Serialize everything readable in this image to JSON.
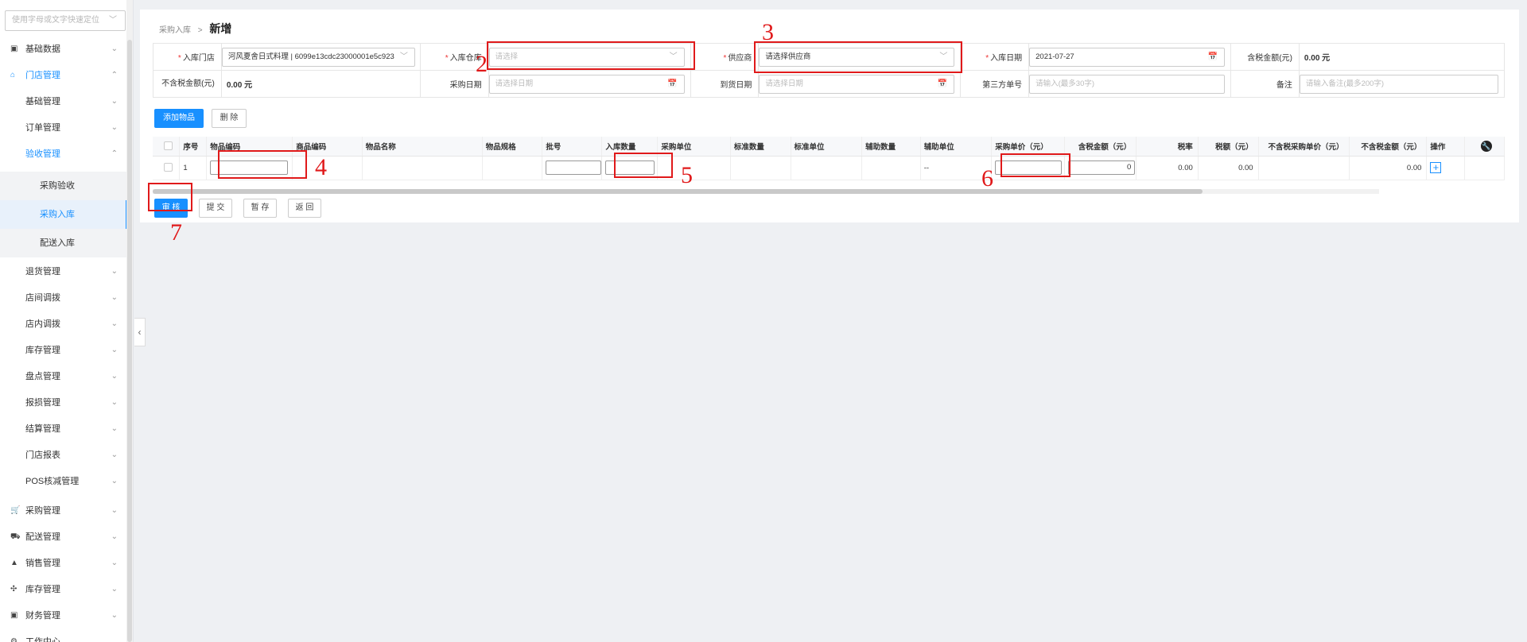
{
  "sidebar": {
    "search_placeholder": "使用字母或文字快速定位",
    "items": [
      {
        "label": "基础数据",
        "icon": "database-icon"
      },
      {
        "label": "门店管理",
        "icon": "store-icon"
      },
      {
        "label": "基础管理"
      },
      {
        "label": "订单管理"
      },
      {
        "label": "验收管理"
      },
      {
        "label": "采购验收"
      },
      {
        "label": "采购入库"
      },
      {
        "label": "配送入库"
      },
      {
        "label": "退货管理"
      },
      {
        "label": "店间调拨"
      },
      {
        "label": "店内调拨"
      },
      {
        "label": "库存管理"
      },
      {
        "label": "盘点管理"
      },
      {
        "label": "报损管理"
      },
      {
        "label": "结算管理"
      },
      {
        "label": "门店报表"
      },
      {
        "label": "POS核减管理"
      },
      {
        "label": "采购管理",
        "icon": "cart-icon"
      },
      {
        "label": "配送管理",
        "icon": "truck-icon"
      },
      {
        "label": "销售管理",
        "icon": "sales-icon"
      },
      {
        "label": "库存管理",
        "icon": "inventory-icon"
      },
      {
        "label": "财务管理",
        "icon": "finance-icon"
      },
      {
        "label": "工作中心",
        "icon": "work-icon"
      }
    ]
  },
  "breadcrumb": {
    "parent": "采购入库",
    "separator": ">",
    "current": "新增"
  },
  "form": {
    "store_label": "入库门店",
    "store_value": "河风夏舍日式料理 | 6099e13cdc23000001e5c923",
    "warehouse_label": "入库仓库",
    "warehouse_placeholder": "请选择",
    "supplier_label": "供应商",
    "supplier_placeholder": "请选择供应商",
    "date_label": "入库日期",
    "date_value": "2021-07-27",
    "tax_amount_label": "含税金额(元)",
    "tax_amount_value": "0.00 元",
    "notax_amount_label": "不含税金额(元)",
    "notax_amount_value": "0.00 元",
    "purchase_date_label": "采购日期",
    "purchase_date_placeholder": "请选择日期",
    "arrival_date_label": "到货日期",
    "arrival_date_placeholder": "请选择日期",
    "third_no_label": "第三方单号",
    "third_no_placeholder": "请输入(最多30字)",
    "remark_label": "备注",
    "remark_placeholder": "请输入备注(最多200字)"
  },
  "toolbar": {
    "add_item": "添加物品",
    "delete": "删 除"
  },
  "grid": {
    "columns": [
      "序号",
      "物品编码",
      "商品编码",
      "物品名称",
      "物品规格",
      "批号",
      "入库数量",
      "采购单位",
      "标准数量",
      "标准单位",
      "辅助数量",
      "辅助单位",
      "采购单价（元）",
      "含税金额（元）",
      "税率",
      "税额（元）",
      "不含税采购单价（元）",
      "不含税金额（元）",
      "操作"
    ],
    "row": {
      "index": "1",
      "aux_unit": "--",
      "tax_amount": "0",
      "tax_rate": "0.00",
      "tax": "0.00",
      "notax_amount": "0.00"
    }
  },
  "actions": {
    "audit": "审 核",
    "submit": "提 交",
    "draft": "暂 存",
    "back": "返 回"
  },
  "annotations": [
    "2",
    "3",
    "4",
    "5",
    "6",
    "7"
  ],
  "colors": {
    "accent": "#1890ff",
    "annotation": "#e0191a"
  }
}
